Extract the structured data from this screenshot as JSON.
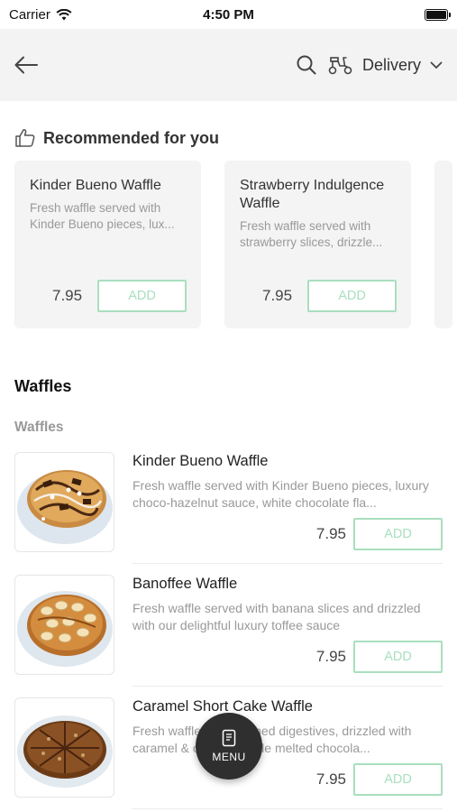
{
  "status_bar": {
    "carrier": "Carrier",
    "time": "4:50 PM"
  },
  "navbar": {
    "delivery_label": "Delivery"
  },
  "recommended": {
    "title": "Recommended for you",
    "items": [
      {
        "name": "Kinder Bueno Waffle",
        "desc": "Fresh waffle served with Kinder Bueno pieces, lux...",
        "price": "7.95",
        "add_label": "ADD"
      },
      {
        "name": "Strawberry Indulgence Waffle",
        "desc": "Fresh waffle served with strawberry slices, drizzle...",
        "price": "7.95",
        "add_label": "ADD"
      }
    ]
  },
  "category": {
    "title": "Waffles",
    "subcategory": "Waffles",
    "items": [
      {
        "name": "Kinder Bueno Waffle",
        "desc": "Fresh waffle served with Kinder Bueno pieces, luxury choco-hazelnut sauce, white chocolate fla...",
        "price": "7.95",
        "add_label": "ADD"
      },
      {
        "name": "Banoffee Waffle",
        "desc": "Fresh waffle served with banana slices and drizzled with our delightful luxury toffee sauce",
        "price": "7.95",
        "add_label": "ADD"
      },
      {
        "name": "Caramel Short Cake Waffle",
        "desc": "Fresh waffle with crushed digestives, drizzled with caramel & our irresistible melted chocola...",
        "price": "7.95",
        "add_label": "ADD"
      }
    ]
  },
  "fab": {
    "label": "MENU"
  },
  "colors": {
    "accent": "#a9dfbf",
    "navbar_bg": "#f3f3f3",
    "card_bg": "#f4f4f4",
    "fab_bg": "#2f2f2f"
  }
}
